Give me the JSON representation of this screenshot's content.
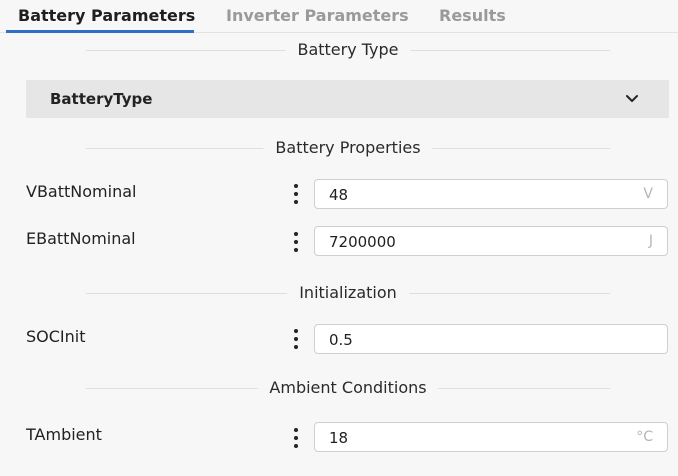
{
  "tabs": [
    {
      "label": "Battery Parameters",
      "active": true
    },
    {
      "label": "Inverter Parameters",
      "active": false
    },
    {
      "label": "Results",
      "active": false
    }
  ],
  "sections": {
    "battery_type": "Battery Type",
    "battery_properties": "Battery Properties",
    "initialization": "Initialization",
    "ambient_conditions": "Ambient Conditions"
  },
  "dropdown": {
    "label": "BatteryType",
    "icon": "chevron-down-icon"
  },
  "params": {
    "vbatt": {
      "label": "VBattNominal",
      "value": "48",
      "unit": "V"
    },
    "ebatt": {
      "label": "EBattNominal",
      "value": "7200000",
      "unit": "J"
    },
    "soc": {
      "label": "SOCInit",
      "value": "0.5",
      "unit": ""
    },
    "tamb": {
      "label": "TAmbient",
      "value": "18",
      "unit": "°C"
    }
  },
  "colors": {
    "accent": "#2f6fc6",
    "background": "#f7f7f7",
    "dropdown_bg": "#e6e6e6"
  }
}
